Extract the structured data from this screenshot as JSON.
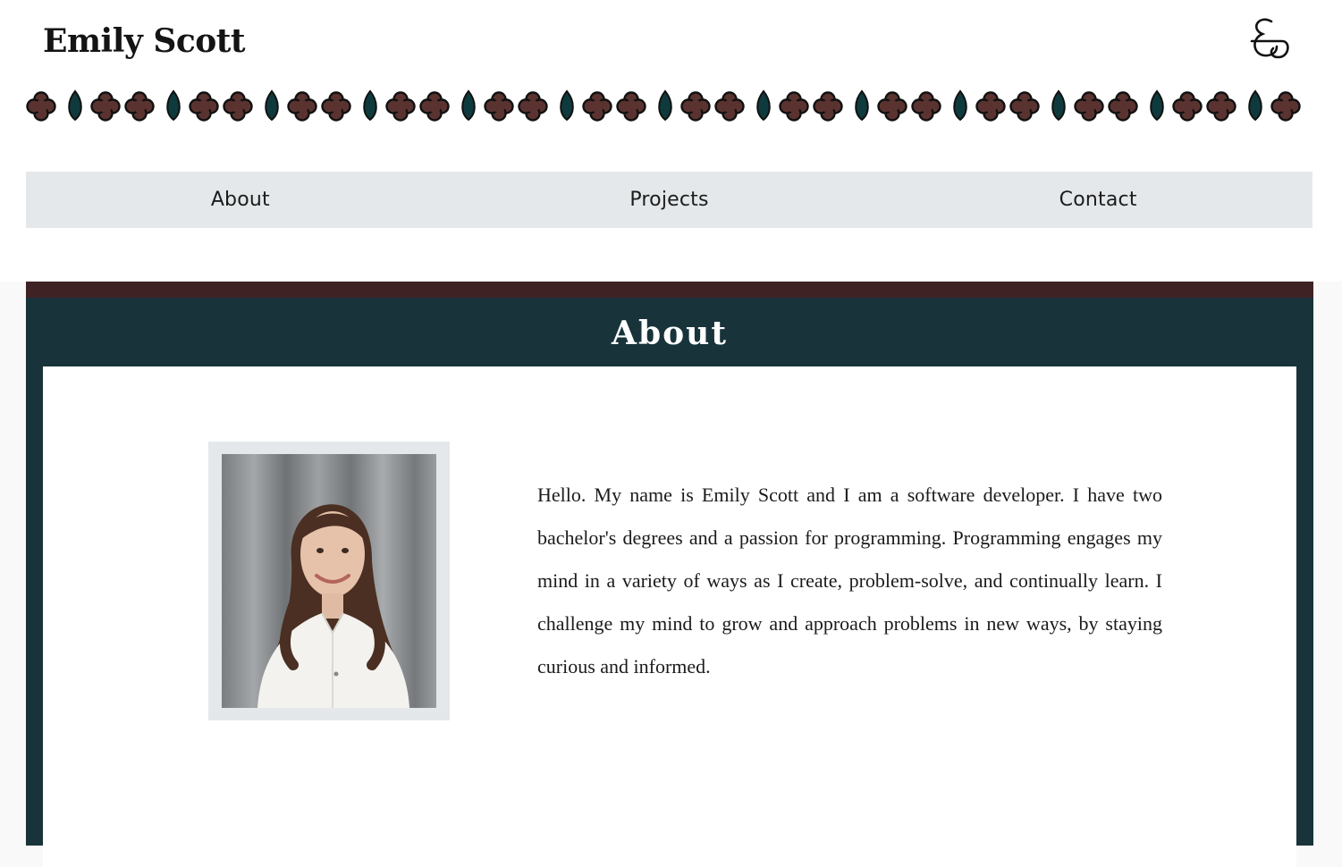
{
  "header": {
    "site_title": "Emily Scott",
    "logo_icon": "es-monogram-icon"
  },
  "decor": {
    "pattern_icons": [
      "quatrefoil-icon",
      "leaf-icon"
    ],
    "colors": {
      "quatrefoil": "#5a3330",
      "leaf": "#0f3a3d",
      "outline": "#111111"
    }
  },
  "nav": {
    "items": [
      {
        "label": "About"
      },
      {
        "label": "Projects"
      },
      {
        "label": "Contact"
      }
    ]
  },
  "about": {
    "heading": "About",
    "photo_alt": "Portrait of Emily Scott",
    "bio": "Hello. My name is Emily Scott and I am a software developer. I have two bachelor's degrees and a passion for programming. Programming engages my mind in a variety of ways as I create, problem-solve, and continually learn. I challenge my mind to grow and approach problems in new ways, by staying curious and informed."
  },
  "theme": {
    "section_bg": "#18333a",
    "section_accent": "#3f2324",
    "nav_bg": "#e4e8ea",
    "frame_bg": "#e4e8ea"
  }
}
